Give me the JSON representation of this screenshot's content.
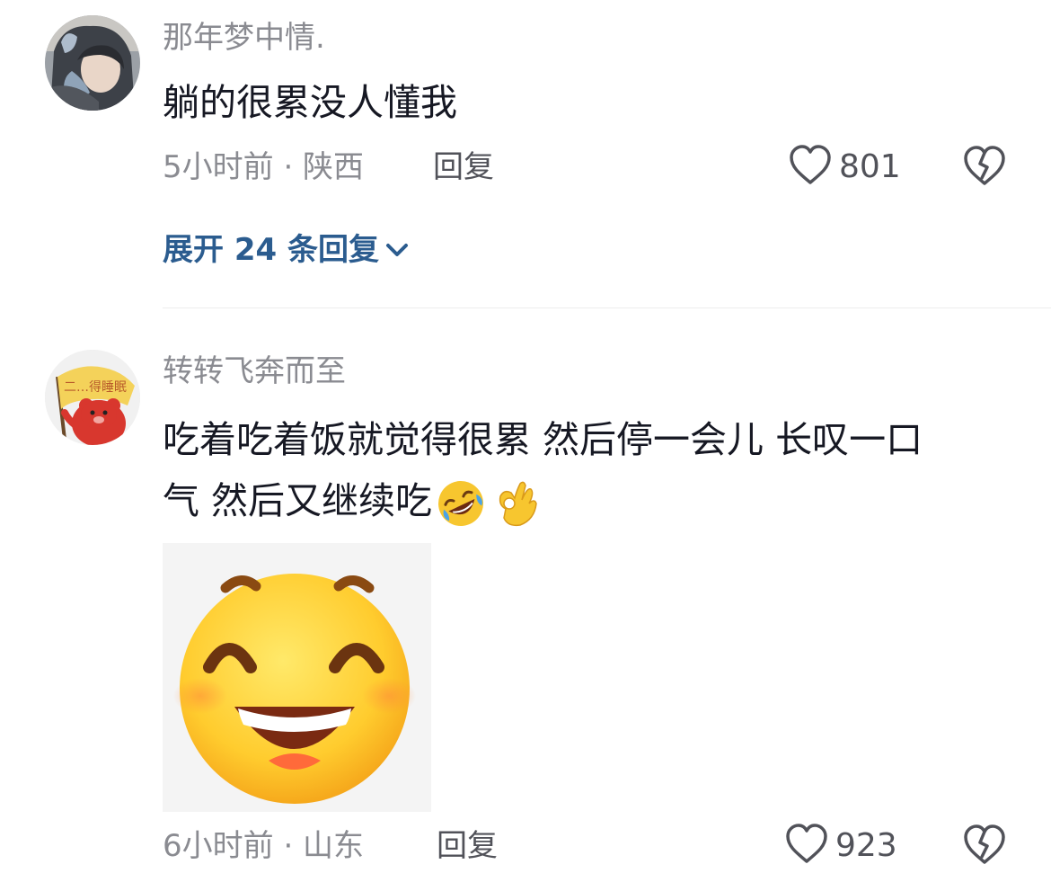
{
  "comments": [
    {
      "username": "那年梦中情.",
      "text": "躺的很累没人懂我",
      "time_location": "5小时前 · 陕西",
      "reply_label": "回复",
      "likes": "801",
      "expand_label": "展开 24 条回复"
    },
    {
      "username": "转转飞奔而至",
      "text_line1": "吃着吃着饭就觉得很累 然后停一会儿 长叹一口",
      "text_line2": "气 然后又继续吃",
      "inline_emojis": [
        "rolling-laugh-emoji",
        "ok-hand-emoji"
      ],
      "sticker": "grinning-face-sticker",
      "avatar_flag_text": "二…得睡眠",
      "time_location": "6小时前 · 山东",
      "reply_label": "回复",
      "likes": "923"
    }
  ],
  "icons": {
    "like": "heart-outline-icon",
    "dislike": "broken-heart-icon",
    "expand": "chevron-down-icon"
  },
  "colors": {
    "username": "#8a8b91",
    "text": "#161823",
    "meta": "#8a8b91",
    "expand_link": "#2b5c8f",
    "divider": "#ededed"
  }
}
